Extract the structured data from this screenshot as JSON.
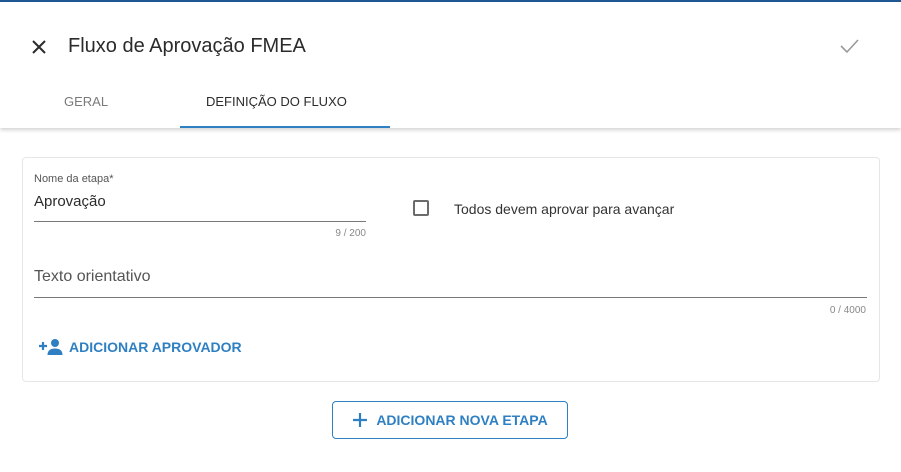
{
  "dialog": {
    "title": "Fluxo de Aprovação FMEA",
    "close_icon": "close-icon",
    "confirm_icon": "check-icon"
  },
  "tabs": [
    {
      "label": "GERAL",
      "active": false
    },
    {
      "label": "DEFINIÇÃO DO FLUXO",
      "active": true
    }
  ],
  "step": {
    "name_label": "Nome da etapa*",
    "name_value": "Aprovação",
    "name_counter": "9 / 200",
    "all_must_approve_label": "Todos devem aprovar para avançar",
    "all_must_approve_checked": false,
    "guidance_placeholder": "Texto orientativo",
    "guidance_counter": "0 / 4000",
    "add_approver_label": "ADICIONAR APROVADOR",
    "add_approver_icon": "add-person-icon"
  },
  "actions": {
    "add_step_label": "ADICIONAR NOVA ETAPA",
    "add_step_icon": "plus-icon"
  },
  "colors": {
    "accent": "#2f80c3",
    "top_bar": "#1f5a96"
  }
}
